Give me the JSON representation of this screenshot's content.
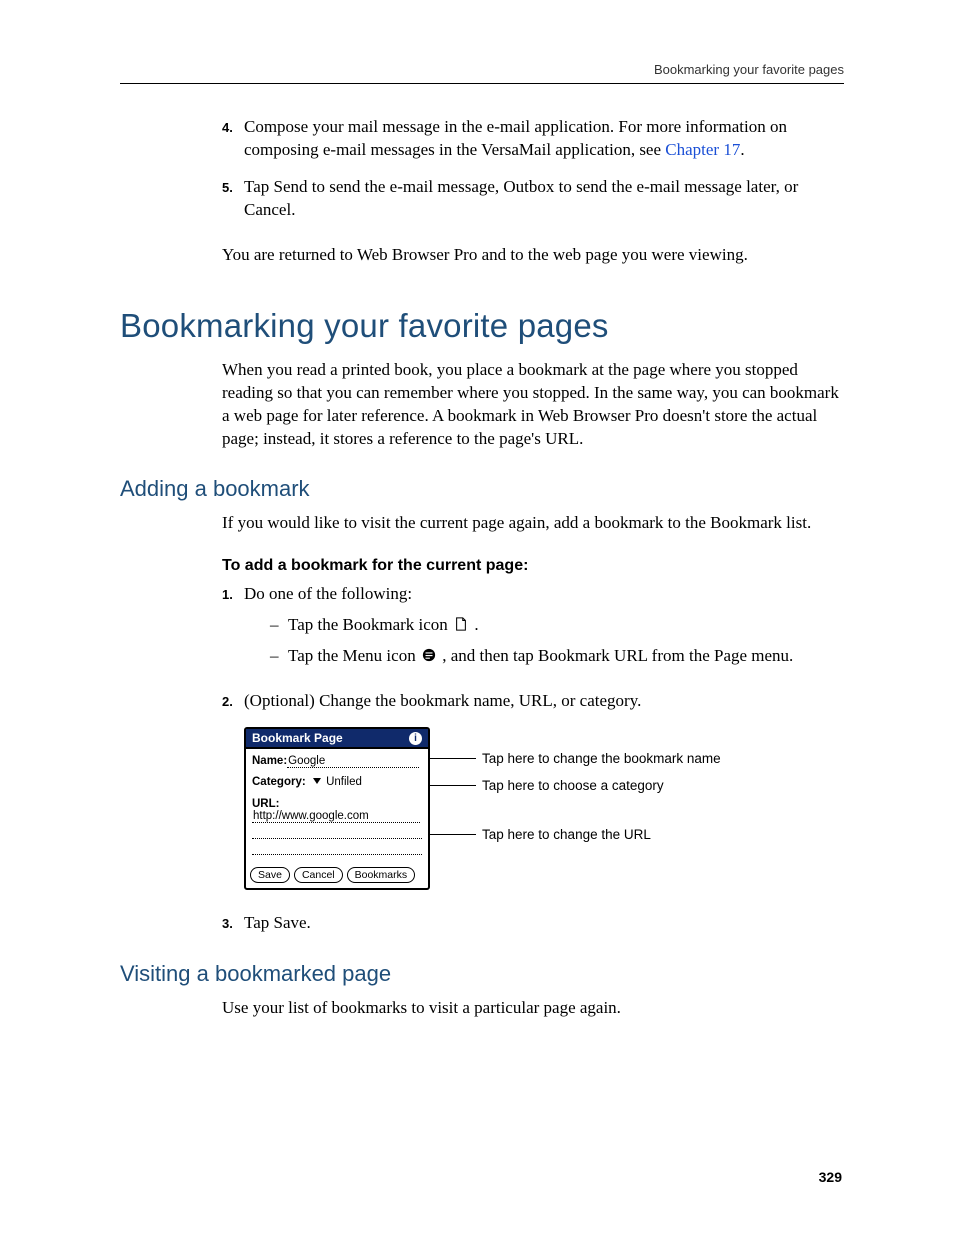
{
  "header": {
    "running": "Bookmarking your favorite pages"
  },
  "steps_a": {
    "n4": "4.",
    "t4a": "Compose your mail message in the e-mail application. For more information on composing e-mail messages in the VersaMail application, see ",
    "t4link": "Chapter 17",
    "t4b": ".",
    "n5": "5.",
    "t5": "Tap Send to send the e-mail message, Outbox to send the e-mail message later, or Cancel."
  },
  "return_para": "You are returned to Web Browser Pro and to the web page you were viewing.",
  "h1": "Bookmarking your favorite pages",
  "h1_para": "When you read a printed book, you place a bookmark at the page where you stopped reading so that you can remember where you stopped. In the same way, you can bookmark a web page for later reference. A bookmark in Web Browser Pro doesn't store the actual page; instead, it stores a reference to the page's URL.",
  "h2a": "Adding a bookmark",
  "h2a_para": "If you would like to visit the current page again, add a bookmark to the Bookmark list.",
  "runin": "To add a bookmark for the current page:",
  "ol2": {
    "n1": "1.",
    "t1": "Do one of the following:",
    "s1a": "Tap the Bookmark icon ",
    "s1b": ".",
    "s2a": "Tap the Menu icon ",
    "s2b": ", and then tap Bookmark URL from the Page menu.",
    "n2": "2.",
    "t2": "(Optional) Change the bookmark name, URL, or category.",
    "n3": "3.",
    "t3": "Tap Save."
  },
  "dialog": {
    "title": "Bookmark Page",
    "name_label": "Name:",
    "name_value": "Google",
    "cat_label": "Category:",
    "cat_value": "Unfiled",
    "url_label": "URL:",
    "url_value": "http://www.google.com",
    "btn_save": "Save",
    "btn_cancel": "Cancel",
    "btn_bookmarks": "Bookmarks"
  },
  "callouts": {
    "c1": "Tap here to change the bookmark name",
    "c2": "Tap here to choose a category",
    "c3": "Tap here to change the URL"
  },
  "h2b": "Visiting a bookmarked page",
  "h2b_para": "Use your list of bookmarks to visit a particular page again.",
  "page_num": "329"
}
